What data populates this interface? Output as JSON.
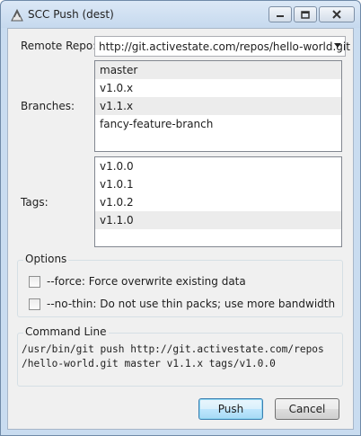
{
  "window": {
    "title": "SCC Push (dest)"
  },
  "remote_repo": {
    "label": "Remote Repo:",
    "value": "http://git.activestate.com/repos/hello-world.git"
  },
  "branches": {
    "label": "Branches:",
    "items": [
      "master",
      "v1.0.x",
      "v1.1.x",
      "fancy-feature-branch"
    ]
  },
  "tags": {
    "label": "Tags:",
    "items": [
      "v1.0.0",
      "v1.0.1",
      "v1.0.2",
      "v1.1.0"
    ]
  },
  "options": {
    "title": "Options",
    "force_label": "--force: Force overwrite existing data",
    "force_checked": false,
    "nothin_label": "--no-thin: Do not use thin packs; use more bandwidth",
    "nothin_checked": false
  },
  "command_line": {
    "title": "Command Line",
    "line1": "/usr/bin/git push http://git.activestate.com/repos",
    "line2": "/hello-world.git master v1.1.x tags/v1.0.0"
  },
  "buttons": {
    "push": "Push",
    "cancel": "Cancel"
  }
}
